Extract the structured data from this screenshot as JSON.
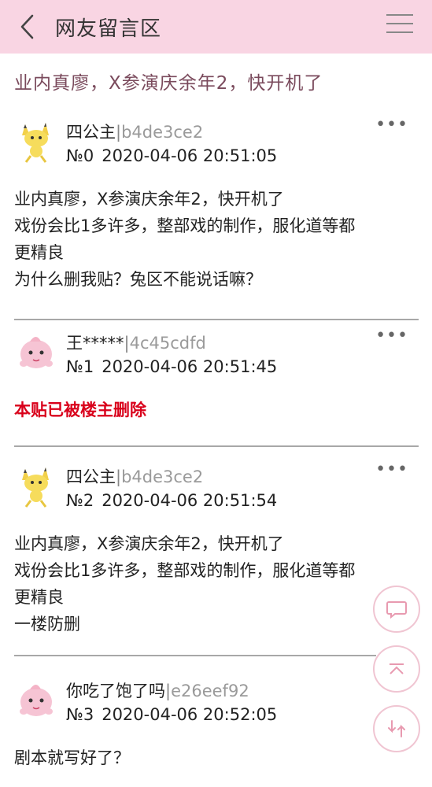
{
  "header": {
    "title": "网友留言区"
  },
  "topic": "业内真廖，X参演庆余年2，快开机了",
  "posts": [
    {
      "author": "四公主",
      "sep": "|",
      "uid": "b4de3ce2",
      "floor": "№0",
      "time": "2020-04-06 20:51:05",
      "lines": [
        "业内真廖，X参演庆余年2，快开机了",
        "戏份会比1多许多，整部戏的制作，服化道等都",
        "更精良",
        "为什么删我贴？兔区不能说话嘛？"
      ]
    },
    {
      "author": "王*****",
      "sep": "|",
      "uid": "4c45cdfd",
      "floor": "№1",
      "time": "2020-04-06 20:51:45",
      "deleted": "本贴已被楼主删除"
    },
    {
      "author": "四公主",
      "sep": "|",
      "uid": "b4de3ce2",
      "floor": "№2",
      "time": "2020-04-06 20:51:54",
      "lines": [
        "业内真廖，X参演庆余年2，快开机了",
        "戏份会比1多许多，整部戏的制作，服化道等都",
        "更精良",
        "一楼防删"
      ]
    },
    {
      "author": "你吃了饱了吗",
      "sep": "|",
      "uid": "e26eef92",
      "floor": "№3",
      "time": "2020-04-06 20:52:05",
      "lines": [
        "剧本就写好了？"
      ]
    }
  ],
  "icons": {
    "back": "chevron-left-icon",
    "menu": "hamburger-menu-icon",
    "more": "more-dots-icon",
    "comment": "comment-bubble-icon",
    "top": "scroll-top-icon",
    "refresh": "refresh-icon",
    "avatar_yellow": "yellow-pokemon-avatar",
    "avatar_pink": "pink-pokemon-avatar"
  },
  "colors": {
    "header_bg": "#f9d5e3",
    "topic": "#7a4a5c",
    "deleted": "#d9001b",
    "uid": "#9a9a9a",
    "fab_border": "#f0c5d2"
  }
}
